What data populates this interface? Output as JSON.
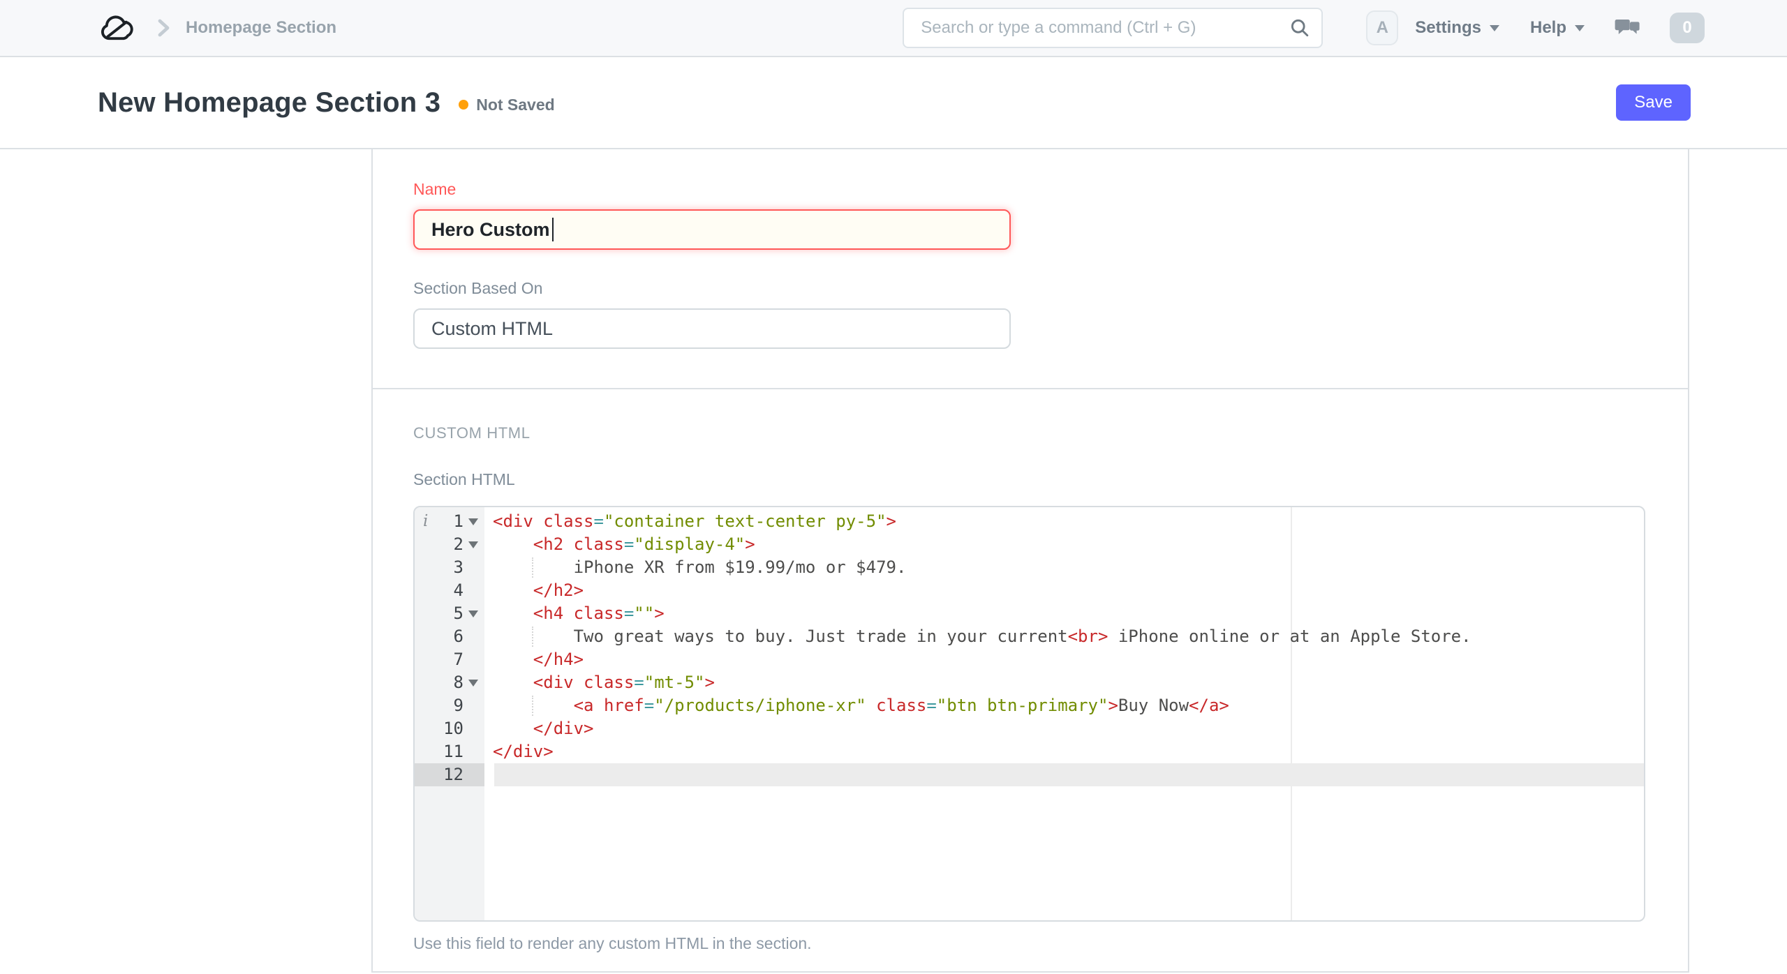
{
  "navbar": {
    "breadcrumb": "Homepage Section",
    "search_placeholder": "Search or type a command (Ctrl + G)",
    "avatar_letter": "A",
    "settings_label": "Settings",
    "help_label": "Help",
    "notification_count": "0"
  },
  "page_head": {
    "title": "New Homepage Section 3",
    "status": "Not Saved",
    "status_color": "#ffa00a",
    "save_label": "Save",
    "primary_color": "#5e64ff"
  },
  "form": {
    "name_field": {
      "label": "Name",
      "value": "Hero Custom"
    },
    "based_on_field": {
      "label": "Section Based On",
      "value": "Custom HTML"
    },
    "section_heading": "CUSTOM HTML",
    "html_field_label": "Section HTML",
    "help_text": "Use this field to render any custom HTML in the section."
  },
  "editor": {
    "colors": {
      "tag": "#c82829",
      "attribute": "#c82829",
      "operator": "#3e999f",
      "string": "#718c00",
      "text": "#4d4d4c"
    },
    "lines": [
      {
        "n": "1",
        "fold": true,
        "info": true,
        "tokens": [
          [
            "t",
            "<div "
          ],
          [
            "a",
            "class"
          ],
          [
            "o",
            "="
          ],
          [
            "s",
            "\"container text-center py-5\""
          ],
          [
            "t",
            ">"
          ]
        ]
      },
      {
        "n": "2",
        "fold": true,
        "tokens": [
          [
            "x",
            "    "
          ],
          [
            "t",
            "<h2 "
          ],
          [
            "a",
            "class"
          ],
          [
            "o",
            "="
          ],
          [
            "s",
            "\"display-4\""
          ],
          [
            "t",
            ">"
          ]
        ]
      },
      {
        "n": "3",
        "guide": true,
        "tokens": [
          [
            "x",
            "        iPhone XR from $19.99/mo or $479."
          ]
        ]
      },
      {
        "n": "4",
        "tokens": [
          [
            "x",
            "    "
          ],
          [
            "t",
            "</h2>"
          ]
        ]
      },
      {
        "n": "5",
        "fold": true,
        "tokens": [
          [
            "x",
            "    "
          ],
          [
            "t",
            "<h4 "
          ],
          [
            "a",
            "class"
          ],
          [
            "o",
            "="
          ],
          [
            "s",
            "\"\""
          ],
          [
            "t",
            ">"
          ]
        ]
      },
      {
        "n": "6",
        "guide": true,
        "tokens": [
          [
            "x",
            "        Two great ways to buy. Just trade in your current"
          ],
          [
            "t",
            "<br>"
          ],
          [
            "x",
            " iPhone online or at an Apple Store."
          ]
        ]
      },
      {
        "n": "7",
        "tokens": [
          [
            "x",
            "    "
          ],
          [
            "t",
            "</h4>"
          ]
        ]
      },
      {
        "n": "8",
        "fold": true,
        "tokens": [
          [
            "x",
            "    "
          ],
          [
            "t",
            "<div "
          ],
          [
            "a",
            "class"
          ],
          [
            "o",
            "="
          ],
          [
            "s",
            "\"mt-5\""
          ],
          [
            "t",
            ">"
          ]
        ]
      },
      {
        "n": "9",
        "guide": true,
        "tokens": [
          [
            "x",
            "        "
          ],
          [
            "t",
            "<a "
          ],
          [
            "a",
            "href"
          ],
          [
            "o",
            "="
          ],
          [
            "s",
            "\"/products/iphone-xr\""
          ],
          [
            "x",
            " "
          ],
          [
            "a",
            "class"
          ],
          [
            "o",
            "="
          ],
          [
            "s",
            "\"btn btn-primary\""
          ],
          [
            "t",
            ">"
          ],
          [
            "x",
            "Buy Now"
          ],
          [
            "t",
            "</a>"
          ]
        ]
      },
      {
        "n": "10",
        "tokens": [
          [
            "x",
            "    "
          ],
          [
            "t",
            "</div>"
          ]
        ]
      },
      {
        "n": "11",
        "tokens": [
          [
            "t",
            "</div>"
          ]
        ]
      },
      {
        "n": "12",
        "active": true,
        "tokens": []
      }
    ]
  }
}
